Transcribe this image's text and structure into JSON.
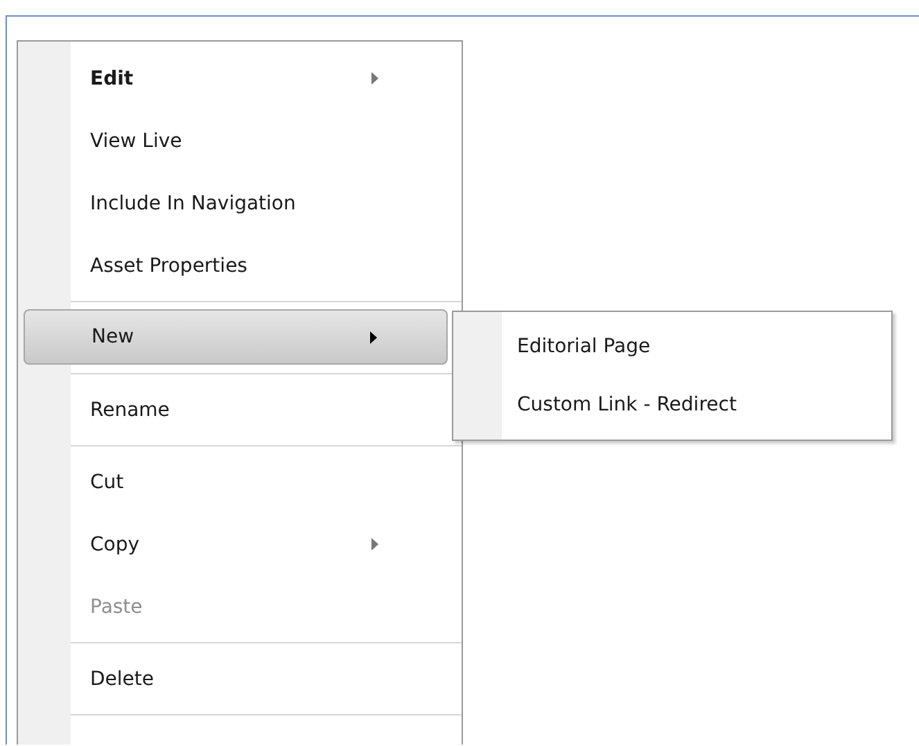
{
  "menu": {
    "items": [
      {
        "kind": "item",
        "label": "Edit",
        "bold": true,
        "has_submenu": true,
        "disabled": false,
        "selected": false
      },
      {
        "kind": "item",
        "label": "View Live",
        "bold": false,
        "has_submenu": false,
        "disabled": false,
        "selected": false
      },
      {
        "kind": "item",
        "label": "Include In Navigation",
        "bold": false,
        "has_submenu": false,
        "disabled": false,
        "selected": false
      },
      {
        "kind": "item",
        "label": "Asset Properties",
        "bold": false,
        "has_submenu": false,
        "disabled": false,
        "selected": false
      },
      {
        "kind": "separator"
      },
      {
        "kind": "item",
        "label": "New",
        "bold": false,
        "has_submenu": true,
        "disabled": false,
        "selected": true
      },
      {
        "kind": "separator"
      },
      {
        "kind": "item",
        "label": "Rename",
        "bold": false,
        "has_submenu": false,
        "disabled": false,
        "selected": false
      },
      {
        "kind": "separator"
      },
      {
        "kind": "item",
        "label": "Cut",
        "bold": false,
        "has_submenu": false,
        "disabled": false,
        "selected": false
      },
      {
        "kind": "item",
        "label": "Copy",
        "bold": false,
        "has_submenu": true,
        "disabled": false,
        "selected": false
      },
      {
        "kind": "item",
        "label": "Paste",
        "bold": false,
        "has_submenu": false,
        "disabled": true,
        "selected": false
      },
      {
        "kind": "separator"
      },
      {
        "kind": "item",
        "label": "Delete",
        "bold": false,
        "has_submenu": false,
        "disabled": false,
        "selected": false
      },
      {
        "kind": "separator"
      }
    ]
  },
  "submenu": {
    "items": [
      {
        "label": "Editorial Page"
      },
      {
        "label": "Custom Link -  Redirect"
      }
    ]
  }
}
